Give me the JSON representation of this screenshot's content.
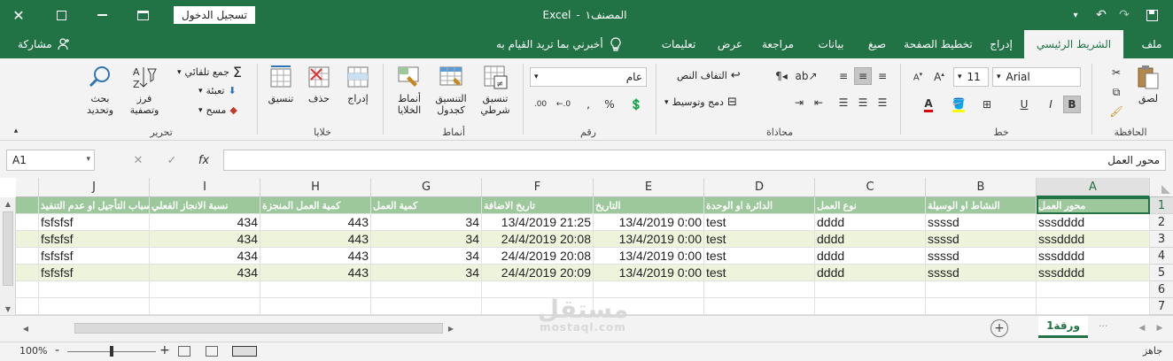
{
  "titlebar": {
    "app": "Excel",
    "separator": "-",
    "doc_name": "المصنف١",
    "signin_label": "تسجيل الدخول"
  },
  "tabs": [
    {
      "id": "file",
      "label": "ملف"
    },
    {
      "id": "home",
      "label": "الشريط الرئيسي"
    },
    {
      "id": "insert",
      "label": "إدراج"
    },
    {
      "id": "pagelayout",
      "label": "تخطيط الصفحة"
    },
    {
      "id": "formulas",
      "label": "صيغ"
    },
    {
      "id": "data",
      "label": "بيانات"
    },
    {
      "id": "review",
      "label": "مراجعة"
    },
    {
      "id": "view",
      "label": "عرض"
    },
    {
      "id": "help",
      "label": "تعليمات"
    }
  ],
  "tellme": {
    "label": "أخبرني بما تريد القيام به"
  },
  "share": {
    "label": "مشاركة"
  },
  "ribbon": {
    "clipboard": {
      "group": "الحافظة",
      "paste": "لصق"
    },
    "font": {
      "group": "خط",
      "font_name": "Arial",
      "font_size": "11",
      "bold": "B",
      "italic": "I",
      "underline": "U"
    },
    "alignment": {
      "group": "محاذاة",
      "wrap": "التفاف النص",
      "merge": "دمج وتوسيط"
    },
    "number": {
      "group": "رقم",
      "format": "عام"
    },
    "styles": {
      "group": "أنماط",
      "conditional": "تنسيق",
      "conditional2": "شرطي",
      "as_table": "التنسيق",
      "as_table2": "كجدول",
      "cell_styles": "أنماط",
      "cell_styles2": "الخلايا"
    },
    "cells": {
      "group": "خلايا",
      "insert": "إدراج",
      "delete": "حذف",
      "format": "تنسيق"
    },
    "editing": {
      "group": "تحرير",
      "autosum": "جمع تلقائي",
      "fill": "تعبئة",
      "clear": "مسح",
      "sort": "فرز",
      "sort2": "وتصفية",
      "find": "بحث",
      "find2": "وتحديد"
    }
  },
  "formula_bar": {
    "namebox": "A1",
    "fx": "fx",
    "formula": "محور العمل"
  },
  "grid": {
    "columns": [
      "A",
      "B",
      "C",
      "D",
      "E",
      "F",
      "G",
      "H",
      "I",
      "J"
    ],
    "rows": [
      "1",
      "2",
      "3",
      "4",
      "5",
      "6",
      "7"
    ],
    "headers": [
      "محور العمل",
      "النشاط او الوسيلة",
      "نوع العمل",
      "الدائرة او الوحدة",
      "التاريخ",
      "تاريخ الاضافة",
      "كمية العمل",
      "كمية العمل المنجزة",
      "نسبة الانجاز الفعلي",
      "اسباب التأجيل او عدم التنفيذ"
    ],
    "data": [
      [
        "sssdddd",
        "ssssd",
        "dddd",
        "test",
        "13/4/2019 0:00",
        "13/4/2019 21:25",
        "34",
        "443",
        "434",
        "fsfsfsf"
      ],
      [
        "sssdddd",
        "ssssd",
        "dddd",
        "test",
        "13/4/2019 0:00",
        "24/4/2019 20:08",
        "34",
        "443",
        "434",
        "fsfsfsf"
      ],
      [
        "sssdddd",
        "ssssd",
        "dddd",
        "test",
        "13/4/2019 0:00",
        "24/4/2019 20:08",
        "34",
        "443",
        "434",
        "fsfsfsf"
      ],
      [
        "sssdddd",
        "ssssd",
        "dddd",
        "test",
        "13/4/2019 0:00",
        "24/4/2019 20:09",
        "34",
        "443",
        "434",
        "fsfsfsf"
      ]
    ]
  },
  "sheets": [
    {
      "label": "ورقة1",
      "active": true
    }
  ],
  "watermark": {
    "text": "مستقل",
    "sub": "mostaql.com"
  },
  "statusbar": {
    "ready": "جاهز",
    "zoom": "100%",
    "zoom_minus": "-",
    "zoom_plus": "+",
    "zoom_fraction": 0.5
  },
  "colors": {
    "brand": "#217346",
    "header_fill": "#9cc89b",
    "band_fill": "#eef3dc"
  }
}
